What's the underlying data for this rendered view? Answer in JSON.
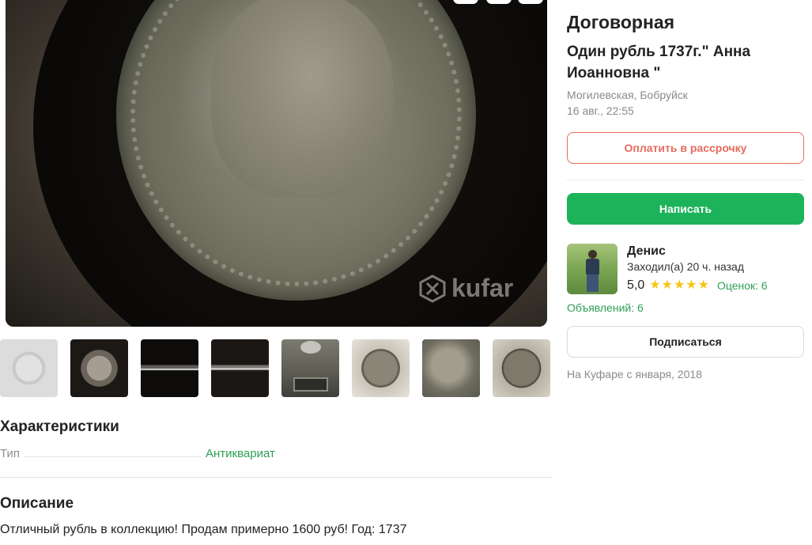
{
  "gallery": {
    "watermark": "kufar",
    "thumbnails": [
      {
        "name": "thumb-coin-white"
      },
      {
        "name": "thumb-coin-eagle"
      },
      {
        "name": "thumb-coin-edge"
      },
      {
        "name": "thumb-coin-edge-2"
      },
      {
        "name": "thumb-coin-scale"
      },
      {
        "name": "thumb-coin-front"
      },
      {
        "name": "thumb-coin-portrait"
      },
      {
        "name": "thumb-coin-front-2"
      }
    ]
  },
  "listing": {
    "price": "Договорная",
    "title": "Один рубль 1737г.\" Анна Иоанновна \"",
    "location": "Могилевская, Бобруйск",
    "date": "16 авг., 22:55",
    "installment_label": "Оплатить в рассрочку",
    "write_label": "Написать"
  },
  "seller": {
    "name": "Денис",
    "last_seen": "Заходил(а) 20 ч. назад",
    "rating": "5,0",
    "stars": 5,
    "reviews_label": "Оценок: 6",
    "ads_label": "Объявлений: 6",
    "subscribe_label": "Подписаться",
    "member_since": "На Куфаре с января, 2018"
  },
  "characteristics": {
    "title": "Характеристики",
    "rows": [
      {
        "key": "Тип",
        "value": "Антиквариат"
      }
    ]
  },
  "description": {
    "title": "Описание",
    "text": "Отличный рубль в коллекцию! Продам примерно 1600 руб! Год: 1737"
  },
  "colors": {
    "accent_green": "#1db35b",
    "installment_red": "#e56b5d",
    "link_green": "#2f9e57",
    "star_yellow": "#f5c518"
  }
}
